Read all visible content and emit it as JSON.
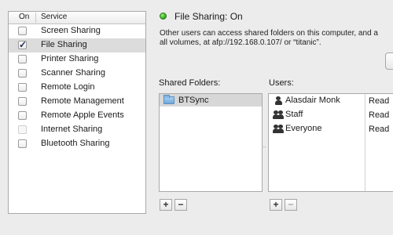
{
  "services": {
    "header_on": "On",
    "header_service": "Service",
    "items": [
      {
        "label": "Screen Sharing",
        "checked": false
      },
      {
        "label": "File Sharing",
        "checked": true
      },
      {
        "label": "Printer Sharing",
        "checked": false
      },
      {
        "label": "Scanner Sharing",
        "checked": false
      },
      {
        "label": "Remote Login",
        "checked": false
      },
      {
        "label": "Remote Management",
        "checked": false
      },
      {
        "label": "Remote Apple Events",
        "checked": false
      },
      {
        "label": "Internet Sharing",
        "checked": false
      },
      {
        "label": "Bluetooth Sharing",
        "checked": false
      }
    ]
  },
  "status": {
    "title": "File Sharing: On",
    "line1": "Other users can access shared folders on this computer, and a",
    "line2": "all volumes, at afp://192.168.0.107/ or “titanic”."
  },
  "shared_folders": {
    "label": "Shared Folders:",
    "items": [
      "BTSync"
    ]
  },
  "users": {
    "label": "Users:",
    "items": [
      {
        "name": "Alasdair Monk",
        "permission": "Read",
        "icon": "single-user-icon"
      },
      {
        "name": "Staff",
        "permission": "Read",
        "icon": "group-icon"
      },
      {
        "name": "Everyone",
        "permission": "Read",
        "icon": "group-icon"
      }
    ]
  },
  "buttons": {
    "add": "+",
    "remove": "−"
  },
  "colors": {
    "status_on": "#2aa31a",
    "selected_row": "#dcdcdc"
  }
}
